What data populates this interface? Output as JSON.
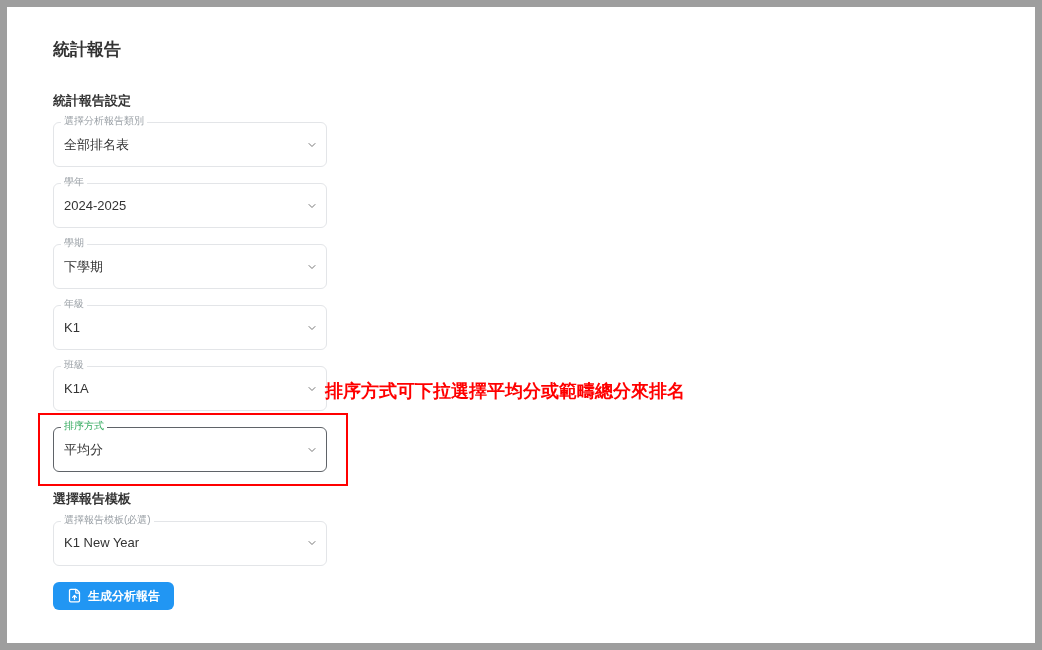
{
  "title": "統計報告",
  "sections": [
    {
      "heading": "統計報告設定",
      "fields": [
        {
          "label": "選擇分析報告類別",
          "value": "全部排名表",
          "focused": false
        },
        {
          "label": "學年",
          "value": "2024-2025",
          "focused": false
        },
        {
          "label": "學期",
          "value": "下學期",
          "focused": false
        },
        {
          "label": "年級",
          "value": "K1",
          "focused": false
        },
        {
          "label": "班級",
          "value": "K1A",
          "focused": false
        },
        {
          "label": "排序方式",
          "value": "平均分",
          "focused": true
        }
      ]
    },
    {
      "heading": "選擇報告模板",
      "fields": [
        {
          "label": "選擇報告模板(必選)",
          "value": "K1 New Year",
          "focused": false
        }
      ]
    }
  ],
  "button": {
    "label": "生成分析報告"
  },
  "annotation": {
    "text": "排序方式可下拉選擇平均分或範疇總分來排名"
  }
}
